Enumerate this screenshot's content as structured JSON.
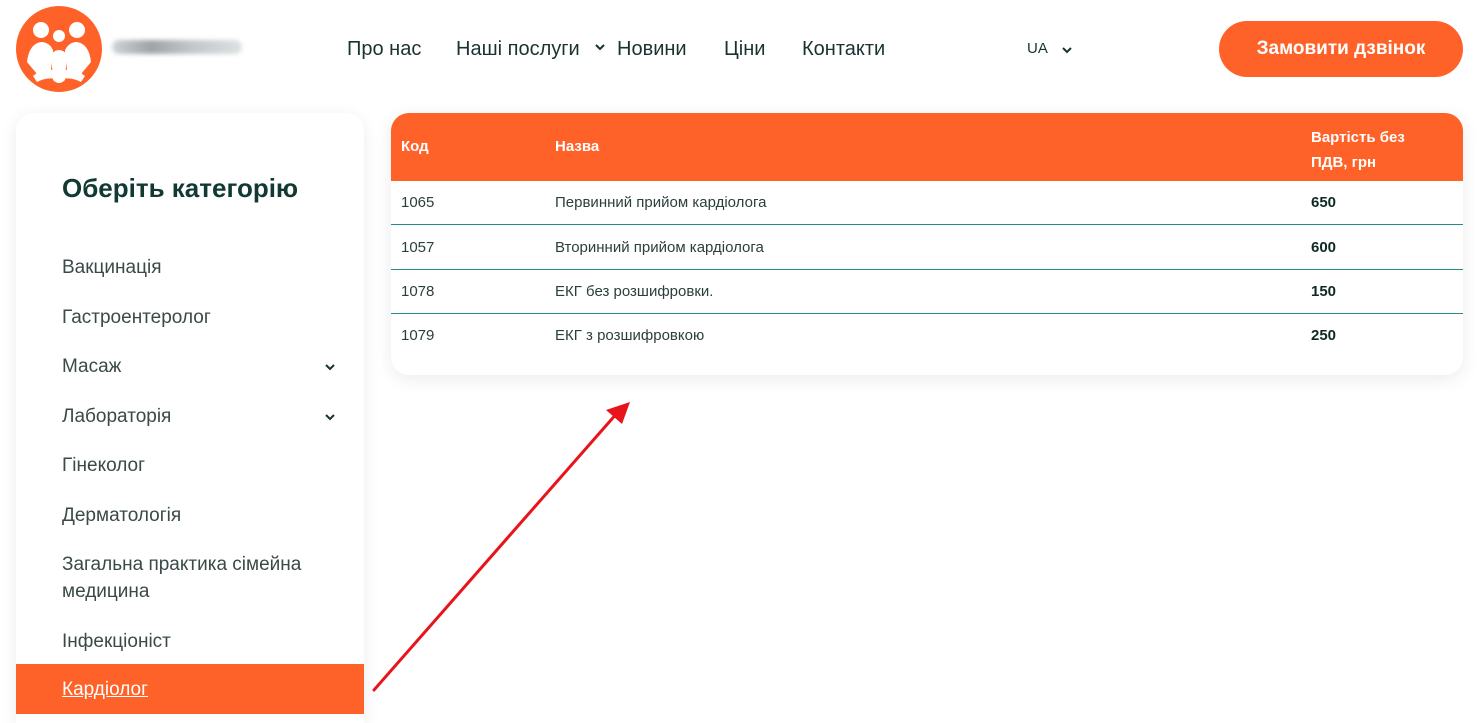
{
  "nav": {
    "items": [
      {
        "label": "Про нас"
      },
      {
        "label": "Наші послуги"
      },
      {
        "label": "Новини"
      },
      {
        "label": "Ціни"
      },
      {
        "label": "Контакти"
      }
    ],
    "language": "UA",
    "cta_label": "Замовити дзвінок"
  },
  "sidebar": {
    "title": "Оберіть категорію",
    "categories": [
      {
        "label": "Вакцинація"
      },
      {
        "label": "Гастроентеролог"
      },
      {
        "label": "Масаж"
      },
      {
        "label": "Лабораторія"
      },
      {
        "label": "Гінеколог"
      },
      {
        "label": "Дерматологія"
      },
      {
        "label": "Загальна практика сімейна медицина"
      },
      {
        "label": "Інфекціоніст"
      },
      {
        "label": "Кардіолог"
      }
    ],
    "active_category": "Кардіолог"
  },
  "table": {
    "headers": {
      "code": "Код",
      "name": "Назва",
      "price": "Вартість без ПДВ, грн"
    },
    "rows": [
      {
        "code": "1065",
        "name": "Первинний прийом кардіолога",
        "price": "650"
      },
      {
        "code": "1057",
        "name": "Вторинний прийом кардіолога",
        "price": "600"
      },
      {
        "code": "1078",
        "name": "ЕКГ без розшифровки.",
        "price": "150"
      },
      {
        "code": "1079",
        "name": "ЕКГ з розшифровкою",
        "price": "250"
      }
    ]
  },
  "colors": {
    "accent": "#ff6228",
    "row_divider": "#1f8c8a",
    "annotation_arrow": "#e8141b"
  },
  "icons": [
    "family-logo-icon",
    "chevron-down-icon",
    "annotation-arrow"
  ]
}
